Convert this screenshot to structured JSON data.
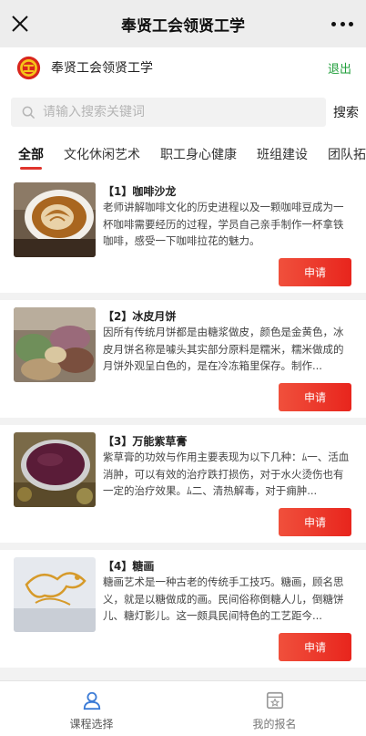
{
  "window": {
    "title": "奉贤工会领贤工学"
  },
  "header": {
    "name": "奉贤工会领贤工学",
    "logout": "退出"
  },
  "search": {
    "placeholder": "请输入搜索关键词",
    "button": "搜索"
  },
  "tabs": [
    {
      "label": "全部",
      "active": true
    },
    {
      "label": "文化休闲艺术"
    },
    {
      "label": "职工身心健康"
    },
    {
      "label": "班组建设"
    },
    {
      "label": "团队拓"
    }
  ],
  "courses": [
    {
      "title": "【1】咖啡沙龙",
      "desc": "老师讲解咖啡文化的历史进程以及一颗咖啡豆成为一杯咖啡需要经历的过程，学员自己亲手制作一杯拿铁咖啡，感受一下咖啡拉花的魅力。",
      "button": "申请"
    },
    {
      "title": "【2】冰皮月饼",
      "desc": "因所有传统月饼都是由糖浆做皮，颜色是金黄色，冰皮月饼名称是噱头其实部分原料是糯米，糯米做成的月饼外观呈白色的，是在冷冻箱里保存。制作...",
      "button": "申请"
    },
    {
      "title": "【3】万能紫草膏",
      "desc": "紫草膏的功效与作用主要表现为以下几种：ﾑ一、活血消肿，可以有效的治疗跌打损伤，对于水火烫伤也有一定的治疗效果。ﾑ二、清热解毒，对于痈肿...",
      "button": "申请"
    },
    {
      "title": "【4】糖画",
      "desc": "糖画艺术是一种古老的传统手工技巧。糖画，顾名思义，就是以糖做成的画。民间俗称倒糖人儿，倒糖饼儿、糖灯影儿。这一颇具民间特色的工艺距今...",
      "button": "申请"
    }
  ],
  "bottom_nav": [
    {
      "label": "课程选择",
      "icon": "user-icon",
      "active": true
    },
    {
      "label": "我的报名",
      "icon": "star-doc-icon"
    }
  ],
  "colors": {
    "accent": "#e8251d",
    "logout": "#1f9e3a",
    "tab_underline": "#e0342c"
  }
}
